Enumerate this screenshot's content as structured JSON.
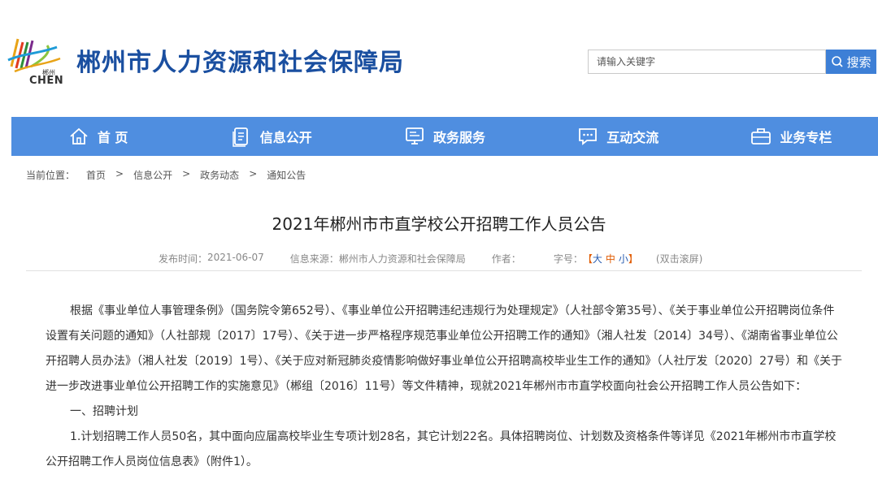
{
  "header": {
    "logo_text": "CHEN",
    "logo_small": "郴州",
    "site_title": "郴州市人力资源和社会保障局",
    "search_placeholder": "请输入关键字",
    "search_button": "搜索"
  },
  "nav": [
    {
      "label": "首 页",
      "icon": "home-icon"
    },
    {
      "label": "信息公开",
      "icon": "document-icon"
    },
    {
      "label": "政务服务",
      "icon": "monitor-icon"
    },
    {
      "label": "互动交流",
      "icon": "chat-icon"
    },
    {
      "label": "业务专栏",
      "icon": "briefcase-icon"
    }
  ],
  "breadcrumb": {
    "prefix": "当前位置：",
    "items": [
      "首页",
      "信息公开",
      "政务动态",
      "通知公告"
    ],
    "separator": ">"
  },
  "article": {
    "title": "2021年郴州市市直学校公开招聘工作人员公告",
    "meta": {
      "date_label": "发布时间：",
      "date": "2021-06-07",
      "source_label": "信息来源：",
      "source": "郴州市人力资源和社会保障局",
      "author_label": "作者：",
      "fontsize_label": "字号：",
      "fs_open": "【",
      "fs_large": "大",
      "fs_medium": "中",
      "fs_small": "小",
      "fs_close": "】",
      "scroll_hint": "(双击滚屏)"
    },
    "paragraphs": [
      "根据《事业单位人事管理条例》（国务院令第652号）、《事业单位公开招聘违纪违规行为处理规定》（人社部令第35号）、《关于事业单位公开招聘岗位条件设置有关问题的通知》（人社部规〔2017〕17号）、《关于进一步严格程序规范事业单位公开招聘工作的通知》（湘人社发〔2014〕34号）、《湖南省事业单位公开招聘人员办法》（湘人社发〔2019〕1号）、《关于应对新冠肺炎疫情影响做好事业单位公开招聘高校毕业生工作的通知》（人社厅发〔2020〕27号）和《关于进一步改进事业单位公开招聘工作的实施意见》（郴组〔2016〕11号）等文件精神，现就2021年郴州市市直学校面向社会公开招聘工作人员公告如下：",
      "一、招聘计划",
      "1.计划招聘工作人员50名，其中面向应届高校毕业生专项计划28名，其它计划22名。具体招聘岗位、计划数及资格条件等详见《2021年郴州市市直学校公开招聘工作人员岗位信息表》（附件1）。"
    ]
  }
}
